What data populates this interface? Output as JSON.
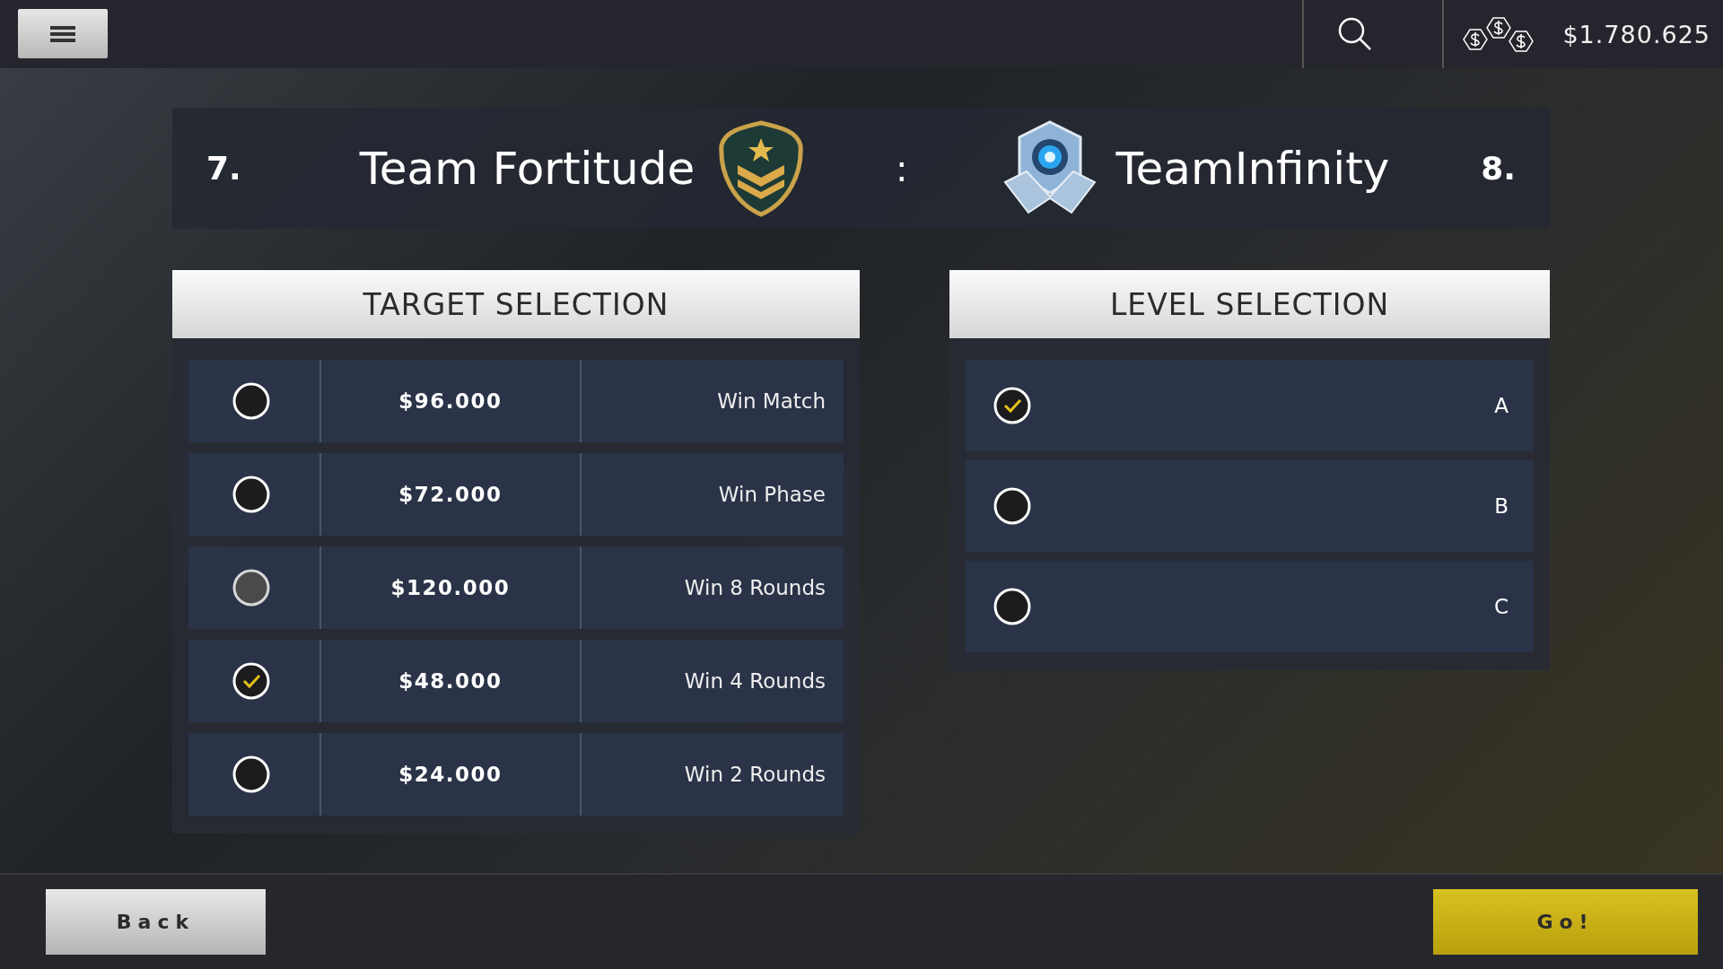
{
  "top_bar": {
    "balance": "$1.780.625"
  },
  "match": {
    "left": {
      "rank": "7.",
      "name": "Team Fortitude"
    },
    "separator": ":",
    "right": {
      "rank": "8.",
      "name": "TeamInfinity"
    }
  },
  "target_selection": {
    "title": "TARGET SELECTION",
    "rows": [
      {
        "reward": "$96.000",
        "goal": "Win Match",
        "selected": false,
        "disabled": false
      },
      {
        "reward": "$72.000",
        "goal": "Win Phase",
        "selected": false,
        "disabled": false
      },
      {
        "reward": "$120.000",
        "goal": "Win 8 Rounds",
        "selected": false,
        "disabled": true
      },
      {
        "reward": "$48.000",
        "goal": "Win 4 Rounds",
        "selected": true,
        "disabled": false
      },
      {
        "reward": "$24.000",
        "goal": "Win 2 Rounds",
        "selected": false,
        "disabled": false
      }
    ]
  },
  "level_selection": {
    "title": "LEVEL SELECTION",
    "rows": [
      {
        "label": "A",
        "selected": true
      },
      {
        "label": "B",
        "selected": false
      },
      {
        "label": "C",
        "selected": false
      }
    ]
  },
  "buttons": {
    "back": "Back",
    "go": "Go!"
  }
}
